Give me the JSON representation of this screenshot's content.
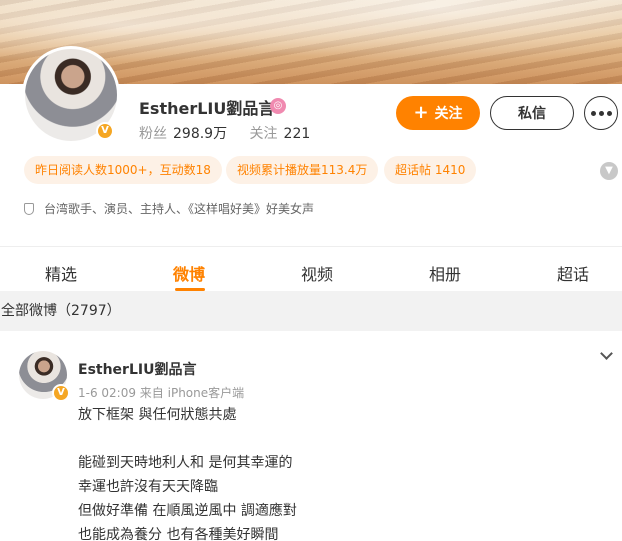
{
  "profile": {
    "name": "EstherLIU劉品言",
    "fans_label": "粉丝",
    "fans_count": "298.9万",
    "following_label": "关注",
    "following_count": "221",
    "bio": "台湾歌手、演员、主持人、《这样唱好美》好美女声"
  },
  "actions": {
    "follow_label": "关注",
    "message_label": "私信"
  },
  "tags": [
    "昨日阅读人数1000+，互动数18",
    "视频累计播放量113.4万",
    "超话帖 1410"
  ],
  "tabs": [
    "精选",
    "微博",
    "视频",
    "相册",
    "超话"
  ],
  "active_tab": "微博",
  "section": {
    "title": "全部微博（2797）"
  },
  "post": {
    "author": "EstherLIU劉品言",
    "meta": "1-6 02:09  来自 iPhone客户端",
    "lines": [
      "放下框架 與任何狀態共處",
      "",
      "能碰到天時地利人和 是何其幸運的",
      "幸運也許沒有天天降臨",
      "但做好準備 在順風逆風中 調適應對",
      "也能成為養分 也有各種美好瞬間"
    ]
  },
  "colors": {
    "accent": "#ff8200",
    "tag_bg": "#fdf1e6",
    "verified": "#f5a623"
  }
}
